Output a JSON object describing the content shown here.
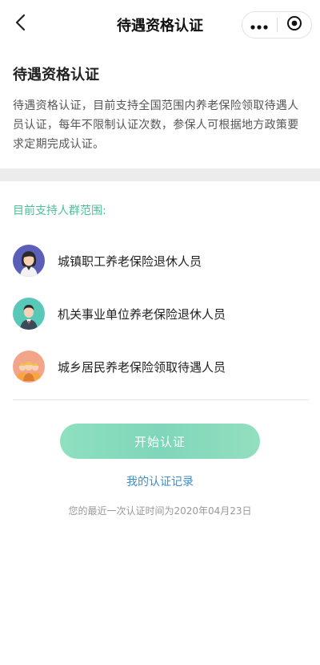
{
  "navbar": {
    "title": "待遇资格认证",
    "back_icon": "chevron-left-icon",
    "more_icon": "more-dots-icon",
    "close_icon": "target-close-icon"
  },
  "intro": {
    "title": "待遇资格认证",
    "text": "待遇资格认证，目前支持全国范围内养老保险领取待遇人员认证，每年不限制认证次数，参保人可根据地方政策要求定期完成认证。"
  },
  "groups": {
    "label": "目前支持人群范围:",
    "items": [
      {
        "label": "城镇职工养老保险退休人员",
        "icon": "female-worker-avatar",
        "bg": "#5b5fb8"
      },
      {
        "label": "机关事业单位养老保险退休人员",
        "icon": "male-official-avatar",
        "bg": "#58c9b8"
      },
      {
        "label": "城乡居民养老保险领取待遇人员",
        "icon": "residents-avatar",
        "bg": "#f3a58a"
      }
    ]
  },
  "actions": {
    "start_label": "开始认证",
    "records_label": "我的认证记录",
    "last_time": "您的最近一次认证时间为2020年04月23日"
  },
  "colors": {
    "accent_green": "#4fbd97",
    "link_blue": "#3f8fc6",
    "button_gradient_start": "#8ee0c0",
    "button_gradient_end": "#93dfbf"
  }
}
